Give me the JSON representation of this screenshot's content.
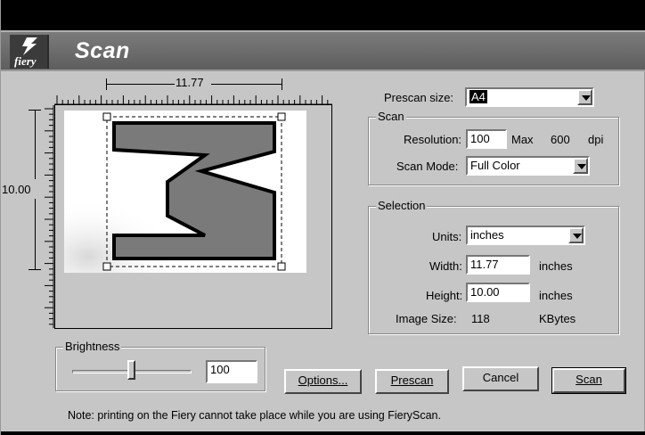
{
  "window": {
    "title": "Scan",
    "logo_text": "fiery"
  },
  "preview": {
    "width_label": "11.77",
    "height_label": "10.00"
  },
  "prescan": {
    "label": "Prescan size:",
    "value": "A4"
  },
  "scan_group": {
    "title": "Scan",
    "resolution_label": "Resolution:",
    "resolution_value": "100",
    "max_label": "Max",
    "max_value": "600",
    "dpi_label": "dpi",
    "mode_label": "Scan Mode:",
    "mode_value": "Full Color"
  },
  "selection_group": {
    "title": "Selection",
    "units_label": "Units:",
    "units_value": "inches",
    "width_label": "Width:",
    "width_value": "11.77",
    "width_unit": "inches",
    "height_label": "Height:",
    "height_value": "10.00",
    "height_unit": "inches",
    "image_size_label": "Image Size:",
    "image_size_value": "118",
    "image_size_unit": "KBytes"
  },
  "brightness": {
    "title": "Brightness",
    "value": "100",
    "level_fraction": 0.5
  },
  "buttons": {
    "options": "Options...",
    "prescan": "Prescan",
    "cancel": "Cancel",
    "scan": "Scan"
  },
  "note": "Note: printing on the Fiery cannot take place while you are using FieryScan."
}
